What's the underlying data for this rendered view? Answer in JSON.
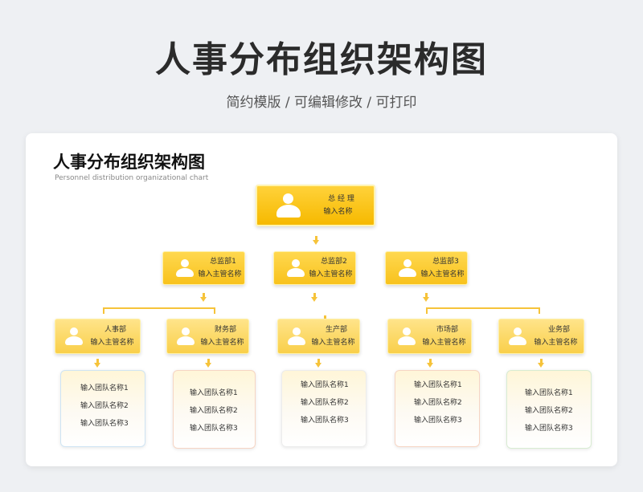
{
  "header": {
    "title": "人事分布组织架构图",
    "subtitle": "简约模版 / 可编辑修改 / 可打印"
  },
  "chart": {
    "title": "人事分布组织架构图",
    "subtitle": "Personnel distribution organizational chart"
  },
  "top": {
    "title": "总 经 理",
    "name": "输入名称"
  },
  "supervisors": [
    {
      "title": "总监部1",
      "name": "输入主管名称"
    },
    {
      "title": "总监部2",
      "name": "输入主管名称"
    },
    {
      "title": "总监部3",
      "name": "输入主管名称"
    }
  ],
  "departments": [
    {
      "title": "人事部",
      "name": "输入主管名称",
      "teams": [
        "输入团队名称1",
        "输入团队名称2",
        "输入团队名称3"
      ]
    },
    {
      "title": "财务部",
      "name": "输入主管名称",
      "teams": [
        "输入团队名称1",
        "输入团队名称2",
        "输入团队名称3"
      ]
    },
    {
      "title": "生产部",
      "name": "输入主管名称",
      "teams": [
        "输入团队名称1",
        "输入团队名称2",
        "输入团队名称3"
      ]
    },
    {
      "title": "市场部",
      "name": "输入主管名称",
      "teams": [
        "输入团队名称1",
        "输入团队名称2",
        "输入团队名称3"
      ]
    },
    {
      "title": "业务部",
      "name": "输入主管名称",
      "teams": [
        "输入团队名称1",
        "输入团队名称2",
        "输入团队名称3"
      ]
    }
  ],
  "colors": {
    "accent": "#f6b900",
    "line": "#f6c33a",
    "background": "#eef0f3"
  }
}
